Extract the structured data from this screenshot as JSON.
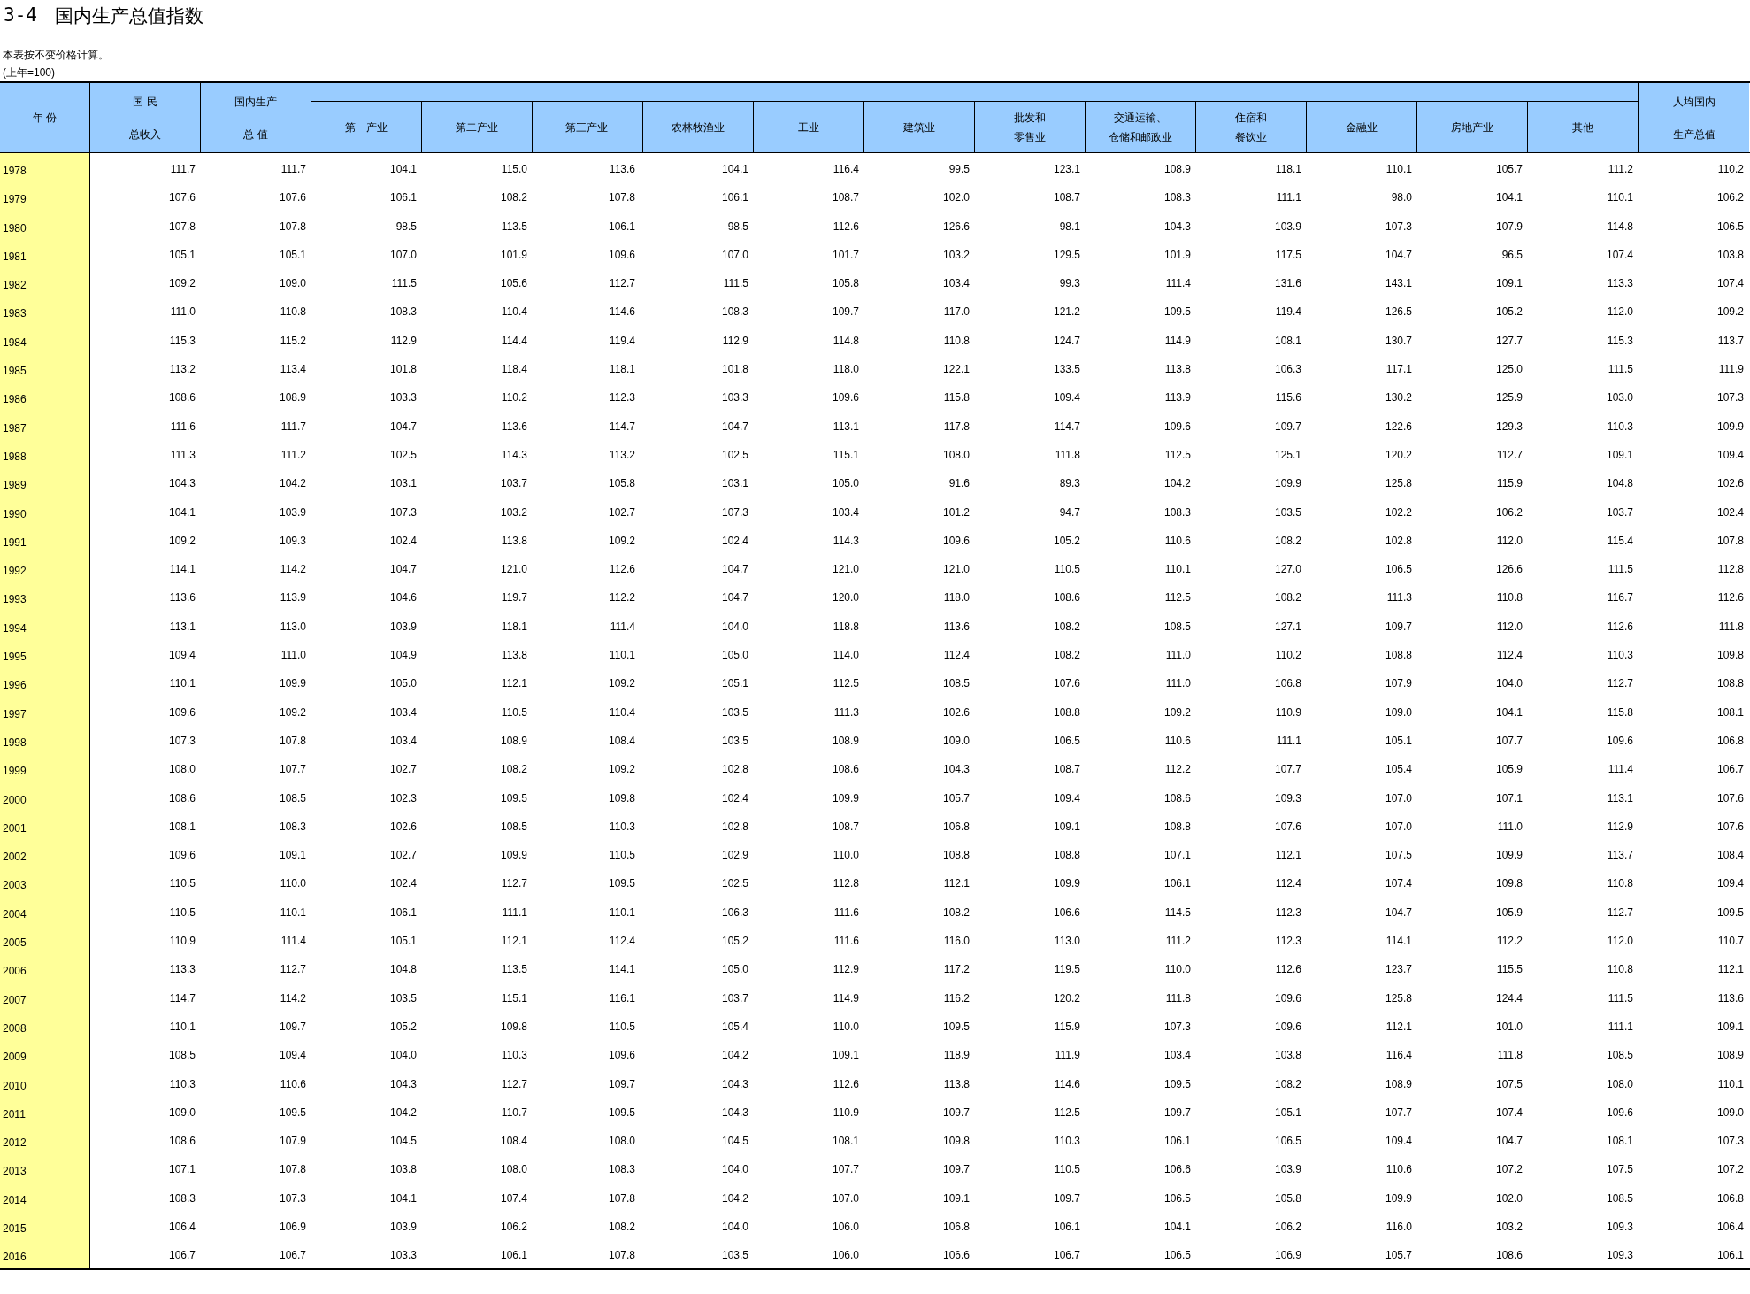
{
  "title": {
    "number": "3-4",
    "text": "国内生产总值指数"
  },
  "notes": [
    "本表按不变价格计算。",
    "(上年=100)"
  ],
  "table": {
    "columns": [
      {
        "kind": "span",
        "lines": [
          "年 份"
        ]
      },
      {
        "kind": "span",
        "lines": [
          "国 民",
          "总收入"
        ]
      },
      {
        "kind": "span",
        "lines": [
          "国内生产",
          "总 值"
        ]
      },
      {
        "kind": "sub",
        "lines": [
          "第一产业"
        ]
      },
      {
        "kind": "sub",
        "lines": [
          "第二产业"
        ]
      },
      {
        "kind": "sub",
        "lines": [
          "第三产业"
        ]
      },
      {
        "kind": "sub",
        "lines": [
          "农林牧渔业"
        ]
      },
      {
        "kind": "sub",
        "lines": [
          "工业"
        ]
      },
      {
        "kind": "sub",
        "lines": [
          "建筑业"
        ]
      },
      {
        "kind": "sub",
        "lines": [
          "批发和",
          "零售业"
        ]
      },
      {
        "kind": "sub",
        "lines": [
          "交通运输、",
          "仓储和邮政业"
        ]
      },
      {
        "kind": "sub",
        "lines": [
          "住宿和",
          "餐饮业"
        ]
      },
      {
        "kind": "sub",
        "lines": [
          "金融业"
        ]
      },
      {
        "kind": "sub",
        "lines": [
          "房地产业"
        ]
      },
      {
        "kind": "sub",
        "lines": [
          "其他"
        ]
      },
      {
        "kind": "span",
        "lines": [
          "人均国内",
          "生产总值"
        ]
      }
    ],
    "rows": [
      [
        "1978",
        "111.7",
        "111.7",
        "104.1",
        "115.0",
        "113.6",
        "104.1",
        "116.4",
        "99.5",
        "123.1",
        "108.9",
        "118.1",
        "110.1",
        "105.7",
        "111.2",
        "110.2"
      ],
      [
        "1979",
        "107.6",
        "107.6",
        "106.1",
        "108.2",
        "107.8",
        "106.1",
        "108.7",
        "102.0",
        "108.7",
        "108.3",
        "111.1",
        "98.0",
        "104.1",
        "110.1",
        "106.2"
      ],
      [
        "1980",
        "107.8",
        "107.8",
        "98.5",
        "113.5",
        "106.1",
        "98.5",
        "112.6",
        "126.6",
        "98.1",
        "104.3",
        "103.9",
        "107.3",
        "107.9",
        "114.8",
        "106.5"
      ],
      [
        "1981",
        "105.1",
        "105.1",
        "107.0",
        "101.9",
        "109.6",
        "107.0",
        "101.7",
        "103.2",
        "129.5",
        "101.9",
        "117.5",
        "104.7",
        "96.5",
        "107.4",
        "103.8"
      ],
      [
        "1982",
        "109.2",
        "109.0",
        "111.5",
        "105.6",
        "112.7",
        "111.5",
        "105.8",
        "103.4",
        "99.3",
        "111.4",
        "131.6",
        "143.1",
        "109.1",
        "113.3",
        "107.4"
      ],
      [
        "1983",
        "111.0",
        "110.8",
        "108.3",
        "110.4",
        "114.6",
        "108.3",
        "109.7",
        "117.0",
        "121.2",
        "109.5",
        "119.4",
        "126.5",
        "105.2",
        "112.0",
        "109.2"
      ],
      [
        "1984",
        "115.3",
        "115.2",
        "112.9",
        "114.4",
        "119.4",
        "112.9",
        "114.8",
        "110.8",
        "124.7",
        "114.9",
        "108.1",
        "130.7",
        "127.7",
        "115.3",
        "113.7"
      ],
      [
        "1985",
        "113.2",
        "113.4",
        "101.8",
        "118.4",
        "118.1",
        "101.8",
        "118.0",
        "122.1",
        "133.5",
        "113.8",
        "106.3",
        "117.1",
        "125.0",
        "111.5",
        "111.9"
      ],
      [
        "1986",
        "108.6",
        "108.9",
        "103.3",
        "110.2",
        "112.3",
        "103.3",
        "109.6",
        "115.8",
        "109.4",
        "113.9",
        "115.6",
        "130.2",
        "125.9",
        "103.0",
        "107.3"
      ],
      [
        "1987",
        "111.6",
        "111.7",
        "104.7",
        "113.6",
        "114.7",
        "104.7",
        "113.1",
        "117.8",
        "114.7",
        "109.6",
        "109.7",
        "122.6",
        "129.3",
        "110.3",
        "109.9"
      ],
      [
        "1988",
        "111.3",
        "111.2",
        "102.5",
        "114.3",
        "113.2",
        "102.5",
        "115.1",
        "108.0",
        "111.8",
        "112.5",
        "125.1",
        "120.2",
        "112.7",
        "109.1",
        "109.4"
      ],
      [
        "1989",
        "104.3",
        "104.2",
        "103.1",
        "103.7",
        "105.8",
        "103.1",
        "105.0",
        "91.6",
        "89.3",
        "104.2",
        "109.9",
        "125.8",
        "115.9",
        "104.8",
        "102.6"
      ],
      [
        "1990",
        "104.1",
        "103.9",
        "107.3",
        "103.2",
        "102.7",
        "107.3",
        "103.4",
        "101.2",
        "94.7",
        "108.3",
        "103.5",
        "102.2",
        "106.2",
        "103.7",
        "102.4"
      ],
      [
        "1991",
        "109.2",
        "109.3",
        "102.4",
        "113.8",
        "109.2",
        "102.4",
        "114.3",
        "109.6",
        "105.2",
        "110.6",
        "108.2",
        "102.8",
        "112.0",
        "115.4",
        "107.8"
      ],
      [
        "1992",
        "114.1",
        "114.2",
        "104.7",
        "121.0",
        "112.6",
        "104.7",
        "121.0",
        "121.0",
        "110.5",
        "110.1",
        "127.0",
        "106.5",
        "126.6",
        "111.5",
        "112.8"
      ],
      [
        "1993",
        "113.6",
        "113.9",
        "104.6",
        "119.7",
        "112.2",
        "104.7",
        "120.0",
        "118.0",
        "108.6",
        "112.5",
        "108.2",
        "111.3",
        "110.8",
        "116.7",
        "112.6"
      ],
      [
        "1994",
        "113.1",
        "113.0",
        "103.9",
        "118.1",
        "111.4",
        "104.0",
        "118.8",
        "113.6",
        "108.2",
        "108.5",
        "127.1",
        "109.7",
        "112.0",
        "112.6",
        "111.8"
      ],
      [
        "1995",
        "109.4",
        "111.0",
        "104.9",
        "113.8",
        "110.1",
        "105.0",
        "114.0",
        "112.4",
        "108.2",
        "111.0",
        "110.2",
        "108.8",
        "112.4",
        "110.3",
        "109.8"
      ],
      [
        "1996",
        "110.1",
        "109.9",
        "105.0",
        "112.1",
        "109.2",
        "105.1",
        "112.5",
        "108.5",
        "107.6",
        "111.0",
        "106.8",
        "107.9",
        "104.0",
        "112.7",
        "108.8"
      ],
      [
        "1997",
        "109.6",
        "109.2",
        "103.4",
        "110.5",
        "110.4",
        "103.5",
        "111.3",
        "102.6",
        "108.8",
        "109.2",
        "110.9",
        "109.0",
        "104.1",
        "115.8",
        "108.1"
      ],
      [
        "1998",
        "107.3",
        "107.8",
        "103.4",
        "108.9",
        "108.4",
        "103.5",
        "108.9",
        "109.0",
        "106.5",
        "110.6",
        "111.1",
        "105.1",
        "107.7",
        "109.6",
        "106.8"
      ],
      [
        "1999",
        "108.0",
        "107.7",
        "102.7",
        "108.2",
        "109.2",
        "102.8",
        "108.6",
        "104.3",
        "108.7",
        "112.2",
        "107.7",
        "105.4",
        "105.9",
        "111.4",
        "106.7"
      ],
      [
        "2000",
        "108.6",
        "108.5",
        "102.3",
        "109.5",
        "109.8",
        "102.4",
        "109.9",
        "105.7",
        "109.4",
        "108.6",
        "109.3",
        "107.0",
        "107.1",
        "113.1",
        "107.6"
      ],
      [
        "2001",
        "108.1",
        "108.3",
        "102.6",
        "108.5",
        "110.3",
        "102.8",
        "108.7",
        "106.8",
        "109.1",
        "108.8",
        "107.6",
        "107.0",
        "111.0",
        "112.9",
        "107.6"
      ],
      [
        "2002",
        "109.6",
        "109.1",
        "102.7",
        "109.9",
        "110.5",
        "102.9",
        "110.0",
        "108.8",
        "108.8",
        "107.1",
        "112.1",
        "107.5",
        "109.9",
        "113.7",
        "108.4"
      ],
      [
        "2003",
        "110.5",
        "110.0",
        "102.4",
        "112.7",
        "109.5",
        "102.5",
        "112.8",
        "112.1",
        "109.9",
        "106.1",
        "112.4",
        "107.4",
        "109.8",
        "110.8",
        "109.4"
      ],
      [
        "2004",
        "110.5",
        "110.1",
        "106.1",
        "111.1",
        "110.1",
        "106.3",
        "111.6",
        "108.2",
        "106.6",
        "114.5",
        "112.3",
        "104.7",
        "105.9",
        "112.7",
        "109.5"
      ],
      [
        "2005",
        "110.9",
        "111.4",
        "105.1",
        "112.1",
        "112.4",
        "105.2",
        "111.6",
        "116.0",
        "113.0",
        "111.2",
        "112.3",
        "114.1",
        "112.2",
        "112.0",
        "110.7"
      ],
      [
        "2006",
        "113.3",
        "112.7",
        "104.8",
        "113.5",
        "114.1",
        "105.0",
        "112.9",
        "117.2",
        "119.5",
        "110.0",
        "112.6",
        "123.7",
        "115.5",
        "110.8",
        "112.1"
      ],
      [
        "2007",
        "114.7",
        "114.2",
        "103.5",
        "115.1",
        "116.1",
        "103.7",
        "114.9",
        "116.2",
        "120.2",
        "111.8",
        "109.6",
        "125.8",
        "124.4",
        "111.5",
        "113.6"
      ],
      [
        "2008",
        "110.1",
        "109.7",
        "105.2",
        "109.8",
        "110.5",
        "105.4",
        "110.0",
        "109.5",
        "115.9",
        "107.3",
        "109.6",
        "112.1",
        "101.0",
        "111.1",
        "109.1"
      ],
      [
        "2009",
        "108.5",
        "109.4",
        "104.0",
        "110.3",
        "109.6",
        "104.2",
        "109.1",
        "118.9",
        "111.9",
        "103.4",
        "103.8",
        "116.4",
        "111.8",
        "108.5",
        "108.9"
      ],
      [
        "2010",
        "110.3",
        "110.6",
        "104.3",
        "112.7",
        "109.7",
        "104.3",
        "112.6",
        "113.8",
        "114.6",
        "109.5",
        "108.2",
        "108.9",
        "107.5",
        "108.0",
        "110.1"
      ],
      [
        "2011",
        "109.0",
        "109.5",
        "104.2",
        "110.7",
        "109.5",
        "104.3",
        "110.9",
        "109.7",
        "112.5",
        "109.7",
        "105.1",
        "107.7",
        "107.4",
        "109.6",
        "109.0"
      ],
      [
        "2012",
        "108.6",
        "107.9",
        "104.5",
        "108.4",
        "108.0",
        "104.5",
        "108.1",
        "109.8",
        "110.3",
        "106.1",
        "106.5",
        "109.4",
        "104.7",
        "108.1",
        "107.3"
      ],
      [
        "2013",
        "107.1",
        "107.8",
        "103.8",
        "108.0",
        "108.3",
        "104.0",
        "107.7",
        "109.7",
        "110.5",
        "106.6",
        "103.9",
        "110.6",
        "107.2",
        "107.5",
        "107.2"
      ],
      [
        "2014",
        "108.3",
        "107.3",
        "104.1",
        "107.4",
        "107.8",
        "104.2",
        "107.0",
        "109.1",
        "109.7",
        "106.5",
        "105.8",
        "109.9",
        "102.0",
        "108.5",
        "106.8"
      ],
      [
        "2015",
        "106.4",
        "106.9",
        "103.9",
        "106.2",
        "108.2",
        "104.0",
        "106.0",
        "106.8",
        "106.1",
        "104.1",
        "106.2",
        "116.0",
        "103.2",
        "109.3",
        "106.4"
      ],
      [
        "2016",
        "106.7",
        "106.7",
        "103.3",
        "106.1",
        "107.8",
        "103.5",
        "106.0",
        "106.6",
        "106.7",
        "106.5",
        "106.9",
        "105.7",
        "108.6",
        "109.3",
        "106.1"
      ]
    ]
  }
}
